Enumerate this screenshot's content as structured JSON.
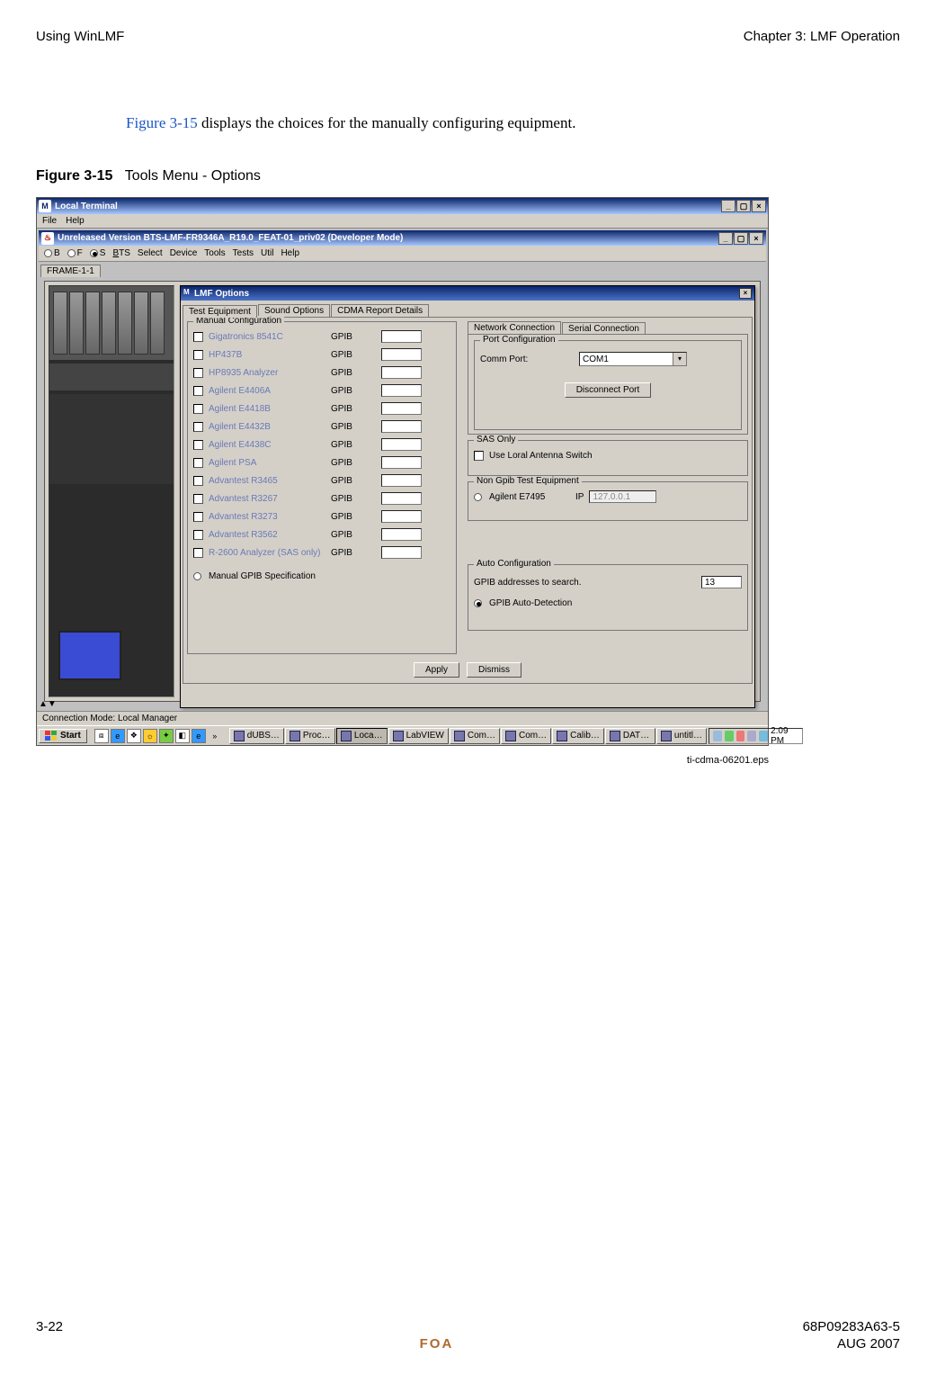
{
  "header": {
    "left": "Using WinLMF",
    "right": "Chapter 3: LMF Operation"
  },
  "body": {
    "fig_ref": "Figure 3-15",
    "sentence_rest": " displays the choices for the manually configuring equipment."
  },
  "figure": {
    "number": "Figure 3-15",
    "title": "Tools Menu - Options"
  },
  "outer_window": {
    "title": "Local Terminal",
    "menu": {
      "file": "File",
      "help": "Help"
    }
  },
  "inner_window": {
    "title": "Unreleased Version BTS-LMF-FR9346A_R19.0_FEAT-01_priv02 (Developer Mode)",
    "radios": {
      "b": "B",
      "f": "F",
      "s": "S"
    },
    "menu": {
      "bts": "BTS",
      "select": "Select",
      "device": "Device",
      "tools": "Tools",
      "tests": "Tests",
      "util": "Util",
      "help": "Help"
    },
    "tab": "FRAME-1-1"
  },
  "dialog": {
    "title": "LMF Options",
    "tabs": {
      "te": "Test Equipment",
      "snd": "Sound Options",
      "cdr": "CDMA Report Details"
    },
    "manual_group": "Manual Configuration",
    "bus_label": "GPIB",
    "equipment": [
      "Gigatronics 8541C",
      "HP437B",
      "HP8935 Analyzer",
      "Agilent E4406A",
      "Agilent E4418B",
      "Agilent E4432B",
      "Agilent E4438C",
      "Agilent PSA",
      "Advantest R3465",
      "Advantest R3267",
      "Advantest R3273",
      "Advantest R3562",
      "R-2600 Analyzer (SAS only)"
    ],
    "manual_gpib_radio": "Manual GPIB Specification",
    "conn_tabs": {
      "net": "Network Connection",
      "ser": "Serial Connection"
    },
    "port_group": "Port Configuration",
    "comm_port_label": "Comm Port:",
    "comm_port_value": "COM1",
    "disconnect_btn": "Disconnect Port",
    "sas_group": "SAS Only",
    "sas_check": "Use Loral Antenna Switch",
    "nongpib_group": "Non Gpib Test Equipment",
    "nongpib_radio": "Agilent E7495",
    "ip_label": "IP",
    "ip_value": "127.0.0.1",
    "auto_group": "Auto Configuration",
    "gpib_search_label": "GPIB addresses to search.",
    "gpib_search_value": "13",
    "gpib_autodetect": "GPIB Auto-Detection",
    "apply": "Apply",
    "dismiss": "Dismiss"
  },
  "connection_mode": "Connection Mode: Local Manager",
  "taskbar": {
    "start": "Start",
    "items": [
      "dUBS…",
      "Proc…",
      "Loca…",
      "LabVIEW",
      "Com…",
      "Com…",
      "Calib…",
      "DAT…",
      "untitl…"
    ],
    "clock": "2:09 PM"
  },
  "eps": "ti-cdma-06201.eps",
  "footer": {
    "page": "3-22",
    "docnum": "68P09283A63-5",
    "foa": "FOA",
    "date": "AUG 2007"
  }
}
